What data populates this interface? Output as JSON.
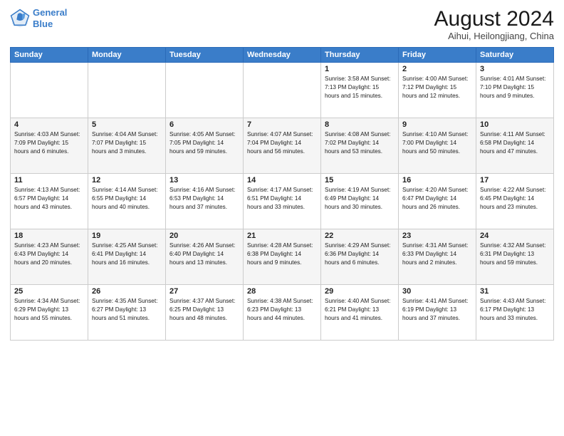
{
  "header": {
    "logo_line1": "General",
    "logo_line2": "Blue",
    "month_year": "August 2024",
    "location": "Aihui, Heilongjiang, China"
  },
  "weekdays": [
    "Sunday",
    "Monday",
    "Tuesday",
    "Wednesday",
    "Thursday",
    "Friday",
    "Saturday"
  ],
  "weeks": [
    [
      {
        "day": "",
        "detail": ""
      },
      {
        "day": "",
        "detail": ""
      },
      {
        "day": "",
        "detail": ""
      },
      {
        "day": "",
        "detail": ""
      },
      {
        "day": "1",
        "detail": "Sunrise: 3:58 AM\nSunset: 7:13 PM\nDaylight: 15 hours\nand 15 minutes."
      },
      {
        "day": "2",
        "detail": "Sunrise: 4:00 AM\nSunset: 7:12 PM\nDaylight: 15 hours\nand 12 minutes."
      },
      {
        "day": "3",
        "detail": "Sunrise: 4:01 AM\nSunset: 7:10 PM\nDaylight: 15 hours\nand 9 minutes."
      }
    ],
    [
      {
        "day": "4",
        "detail": "Sunrise: 4:03 AM\nSunset: 7:09 PM\nDaylight: 15 hours\nand 6 minutes."
      },
      {
        "day": "5",
        "detail": "Sunrise: 4:04 AM\nSunset: 7:07 PM\nDaylight: 15 hours\nand 3 minutes."
      },
      {
        "day": "6",
        "detail": "Sunrise: 4:05 AM\nSunset: 7:05 PM\nDaylight: 14 hours\nand 59 minutes."
      },
      {
        "day": "7",
        "detail": "Sunrise: 4:07 AM\nSunset: 7:04 PM\nDaylight: 14 hours\nand 56 minutes."
      },
      {
        "day": "8",
        "detail": "Sunrise: 4:08 AM\nSunset: 7:02 PM\nDaylight: 14 hours\nand 53 minutes."
      },
      {
        "day": "9",
        "detail": "Sunrise: 4:10 AM\nSunset: 7:00 PM\nDaylight: 14 hours\nand 50 minutes."
      },
      {
        "day": "10",
        "detail": "Sunrise: 4:11 AM\nSunset: 6:58 PM\nDaylight: 14 hours\nand 47 minutes."
      }
    ],
    [
      {
        "day": "11",
        "detail": "Sunrise: 4:13 AM\nSunset: 6:57 PM\nDaylight: 14 hours\nand 43 minutes."
      },
      {
        "day": "12",
        "detail": "Sunrise: 4:14 AM\nSunset: 6:55 PM\nDaylight: 14 hours\nand 40 minutes."
      },
      {
        "day": "13",
        "detail": "Sunrise: 4:16 AM\nSunset: 6:53 PM\nDaylight: 14 hours\nand 37 minutes."
      },
      {
        "day": "14",
        "detail": "Sunrise: 4:17 AM\nSunset: 6:51 PM\nDaylight: 14 hours\nand 33 minutes."
      },
      {
        "day": "15",
        "detail": "Sunrise: 4:19 AM\nSunset: 6:49 PM\nDaylight: 14 hours\nand 30 minutes."
      },
      {
        "day": "16",
        "detail": "Sunrise: 4:20 AM\nSunset: 6:47 PM\nDaylight: 14 hours\nand 26 minutes."
      },
      {
        "day": "17",
        "detail": "Sunrise: 4:22 AM\nSunset: 6:45 PM\nDaylight: 14 hours\nand 23 minutes."
      }
    ],
    [
      {
        "day": "18",
        "detail": "Sunrise: 4:23 AM\nSunset: 6:43 PM\nDaylight: 14 hours\nand 20 minutes."
      },
      {
        "day": "19",
        "detail": "Sunrise: 4:25 AM\nSunset: 6:41 PM\nDaylight: 14 hours\nand 16 minutes."
      },
      {
        "day": "20",
        "detail": "Sunrise: 4:26 AM\nSunset: 6:40 PM\nDaylight: 14 hours\nand 13 minutes."
      },
      {
        "day": "21",
        "detail": "Sunrise: 4:28 AM\nSunset: 6:38 PM\nDaylight: 14 hours\nand 9 minutes."
      },
      {
        "day": "22",
        "detail": "Sunrise: 4:29 AM\nSunset: 6:36 PM\nDaylight: 14 hours\nand 6 minutes."
      },
      {
        "day": "23",
        "detail": "Sunrise: 4:31 AM\nSunset: 6:33 PM\nDaylight: 14 hours\nand 2 minutes."
      },
      {
        "day": "24",
        "detail": "Sunrise: 4:32 AM\nSunset: 6:31 PM\nDaylight: 13 hours\nand 59 minutes."
      }
    ],
    [
      {
        "day": "25",
        "detail": "Sunrise: 4:34 AM\nSunset: 6:29 PM\nDaylight: 13 hours\nand 55 minutes."
      },
      {
        "day": "26",
        "detail": "Sunrise: 4:35 AM\nSunset: 6:27 PM\nDaylight: 13 hours\nand 51 minutes."
      },
      {
        "day": "27",
        "detail": "Sunrise: 4:37 AM\nSunset: 6:25 PM\nDaylight: 13 hours\nand 48 minutes."
      },
      {
        "day": "28",
        "detail": "Sunrise: 4:38 AM\nSunset: 6:23 PM\nDaylight: 13 hours\nand 44 minutes."
      },
      {
        "day": "29",
        "detail": "Sunrise: 4:40 AM\nSunset: 6:21 PM\nDaylight: 13 hours\nand 41 minutes."
      },
      {
        "day": "30",
        "detail": "Sunrise: 4:41 AM\nSunset: 6:19 PM\nDaylight: 13 hours\nand 37 minutes."
      },
      {
        "day": "31",
        "detail": "Sunrise: 4:43 AM\nSunset: 6:17 PM\nDaylight: 13 hours\nand 33 minutes."
      }
    ]
  ]
}
